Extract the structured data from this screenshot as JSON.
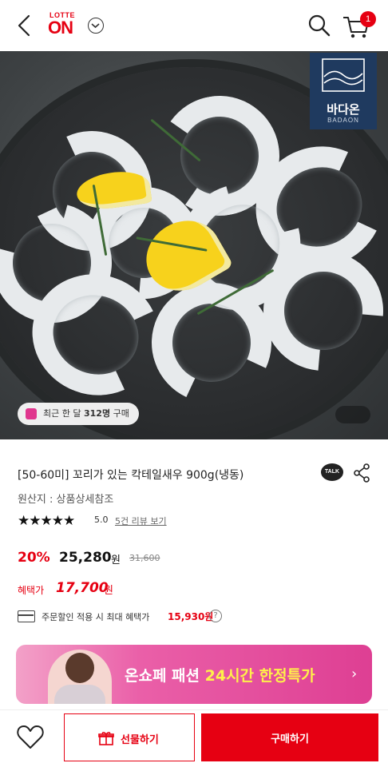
{
  "header": {
    "logo_top": "LOTTE",
    "logo_main": "ON",
    "cart_count": "1"
  },
  "hero": {
    "brand_ko": "바다온",
    "brand_en": "BADAON",
    "buyers_prefix": "최근 한 달",
    "buyers_count": "312명",
    "buyers_suffix": "구매"
  },
  "product": {
    "title": "[50-60미] 꼬리가 있는 칵테일새우 900g(냉동)",
    "origin": "원산지 : 상품상세참조",
    "stars": "★★★★★",
    "score": "5.0",
    "review_link": "5건 리뷰 보기",
    "share_label": "TALK"
  },
  "pricing": {
    "discount": "20%",
    "price": "25,280",
    "price_unit": "원",
    "original_price": "31,600",
    "benefit_label": "혜택가",
    "benefit_price": "17,700",
    "benefit_unit": "원",
    "coupon_text": "주문할인 적용 시 최대 혜택가",
    "coupon_price": "15,930원",
    "help": "?"
  },
  "banner": {
    "text_main": "온쇼페 패션 ",
    "text_highlight": "24시간 한정특가",
    "chevron": "›"
  },
  "bottom": {
    "gift_label": "선물하기",
    "buy_label": "구매하기"
  },
  "colors": {
    "brand_red": "#e60012",
    "banner_pink": "#de3f93",
    "brand_navy": "#1f3a5f"
  },
  "icons": [
    "back-icon",
    "chevron-down-icon",
    "search-icon",
    "cart-icon",
    "kakao-talk-icon",
    "share-icon",
    "card-icon",
    "help-icon",
    "heart-icon",
    "gift-icon",
    "shopping-bag-icon"
  ]
}
